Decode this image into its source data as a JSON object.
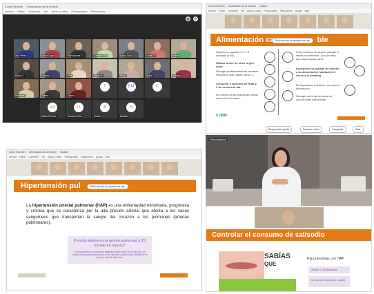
{
  "app": {
    "window_title": "Zoom Reunión",
    "tab2": "Información de la reunión",
    "tab3": "Grabar",
    "menu": [
      "Archivo",
      "Editar",
      "Compartir",
      "Ver",
      "Audio y video",
      "Participantes",
      "Reacciones",
      "Ayuda",
      "Salir"
    ]
  },
  "gallery": {
    "tiles": [
      {
        "name": "Ana Pérez"
      },
      {
        "name": "María López"
      },
      {
        "name": "Participante"
      },
      {
        "name": "Carmen Ruiz"
      },
      {
        "name": "Laura Díaz"
      },
      {
        "name": "Luisa M."
      },
      {
        "name": "Isabel"
      },
      {
        "name": "Rosa G."
      },
      {
        "name": "Invitado"
      },
      {
        "name": "Pilar"
      },
      {
        "name": "Marta S."
      },
      {
        "name": "Elena"
      },
      {
        "name": "Sofía"
      },
      {
        "name": "Susana"
      },
      {
        "name": "Paciente"
      },
      {
        "name": "Teresa"
      },
      {
        "name": "Juana"
      },
      {
        "name": "Beatriz"
      }
    ],
    "avatars": [
      "T",
      "BM",
      "C",
      "DA",
      "U",
      "S",
      "N"
    ],
    "avatar_names": [
      "",
      "",
      "",
      "Marta Gómez",
      "Susana Solar",
      "Beatriz",
      "Natalia"
    ]
  },
  "slide1": {
    "title": "Alimentación car",
    "title_end": "ble",
    "share_notice": "Está viendo la pantalla de Isa",
    "left_items": [
      "Repartir la ingesta en 4 o 5 comidas al día.",
      "Utilizar aceite de oliva virgen extra.",
      "Escoger preferentemente cereales integrales (pan, pasta, arroz...).",
      "Consumir 3 raciones de fruta y 2 de verdura al día.",
      "No olvidar tomar legumbres varias veces a la semana."
    ],
    "right_items": [
      "Como mínimo consumir pescado 4 veces a la semana. Dos de ellas, que sea pescado azul.",
      "Incorporar un puñado de nueces a la alimentación habitual (2-3 veces a la semana).",
      "Es importante mantener una buena hidratación.",
      "Escoger entre las técnicas de cocción más adecuadas."
    ],
    "logo": "CLINIC",
    "toolbar": [
      "Respuesta rápida",
      "Detener vídeo",
      "Compartir",
      "Salir"
    ]
  },
  "slide2": {
    "title": "Hipertensión pul",
    "share_notice": "Está viendo la pantalla de Isa",
    "body_prefix": "La ",
    "body_bold": "hipertensión arterial pulmonar (HAP)",
    "body_rest": " es una enfermedad minoritaria, progresiva y crónica que se caracteriza por la alta presión arterial que afecta a los vasos sanguíneos que transportan la sangre del corazón a los pulmones (arterias pulmonares).",
    "box_main": "Presión media en la arteria pulmonar ≥ 25 mmHg en reposo*",
    "box_small": "* Los parámetros pulmonares estándar están entre 10-20 mmHg y los valores de la presión pulmonar no se calculan a partir de la medida de la presión arterial sistémica."
  },
  "video": {
    "label": "Presentadora"
  },
  "slide3": {
    "title": "Controlar el consumo de sal/sodio",
    "sabias": "SABÍAS",
    "que": "QUE",
    "right_heading": "Para personas con HAP",
    "bullets": [
      "Añadir < 1500mg/día",
      "Menos de 500mg de sal/día"
    ]
  },
  "colors": {
    "orange": "#e07b18",
    "zoom_dark": "#262626",
    "lilac_box": "#ece4f2",
    "green": "#8cc63f"
  }
}
